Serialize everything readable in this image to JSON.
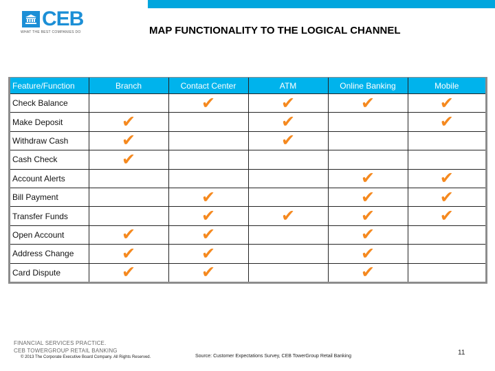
{
  "header": {
    "logo_text": "CEB",
    "logo_tagline": "WHAT THE BEST COMPANIES DO",
    "logo_icon": "bank-building-icon",
    "accent_color": "#00a6de",
    "title": "MAP FUNCTIONALITY TO THE LOGICAL CHANNEL"
  },
  "table": {
    "columns": [
      "Feature/Function",
      "Branch",
      "Contact Center",
      "ATM",
      "Online Banking",
      "Mobile"
    ],
    "check_icon": "checkmark-icon",
    "check_glyph": "✔",
    "check_color": "#f5891f",
    "rows": [
      {
        "feature": "Check Balance",
        "branch": false,
        "contact_center": true,
        "atm": true,
        "online_banking": true,
        "mobile": true
      },
      {
        "feature": "Make Deposit",
        "branch": true,
        "contact_center": false,
        "atm": true,
        "online_banking": false,
        "mobile": true
      },
      {
        "feature": "Withdraw Cash",
        "branch": true,
        "contact_center": false,
        "atm": true,
        "online_banking": false,
        "mobile": false
      },
      {
        "feature": "Cash Check",
        "branch": true,
        "contact_center": false,
        "atm": false,
        "online_banking": false,
        "mobile": false
      },
      {
        "feature": "Account Alerts",
        "branch": false,
        "contact_center": false,
        "atm": false,
        "online_banking": true,
        "mobile": true
      },
      {
        "feature": "Bill Payment",
        "branch": false,
        "contact_center": true,
        "atm": false,
        "online_banking": true,
        "mobile": true
      },
      {
        "feature": "Transfer Funds",
        "branch": false,
        "contact_center": true,
        "atm": true,
        "online_banking": true,
        "mobile": true
      },
      {
        "feature": "Open Account",
        "branch": true,
        "contact_center": true,
        "atm": false,
        "online_banking": true,
        "mobile": false
      },
      {
        "feature": "Address Change",
        "branch": true,
        "contact_center": true,
        "atm": false,
        "online_banking": true,
        "mobile": false
      },
      {
        "feature": "Card Dispute",
        "branch": true,
        "contact_center": true,
        "atm": false,
        "online_banking": true,
        "mobile": false
      }
    ]
  },
  "footer": {
    "practice_line1": "FINANCIAL SERVICES PRACTICE.",
    "practice_line2": "CEB TOWERGROUP RETAIL BANKING",
    "copyright": "© 2013 The Corporate Executive Board Company. All Rights Reserved.",
    "source": "Source: Customer Expectations Survey, CEB TowerGroup Retail Banking",
    "page_number": "11"
  }
}
